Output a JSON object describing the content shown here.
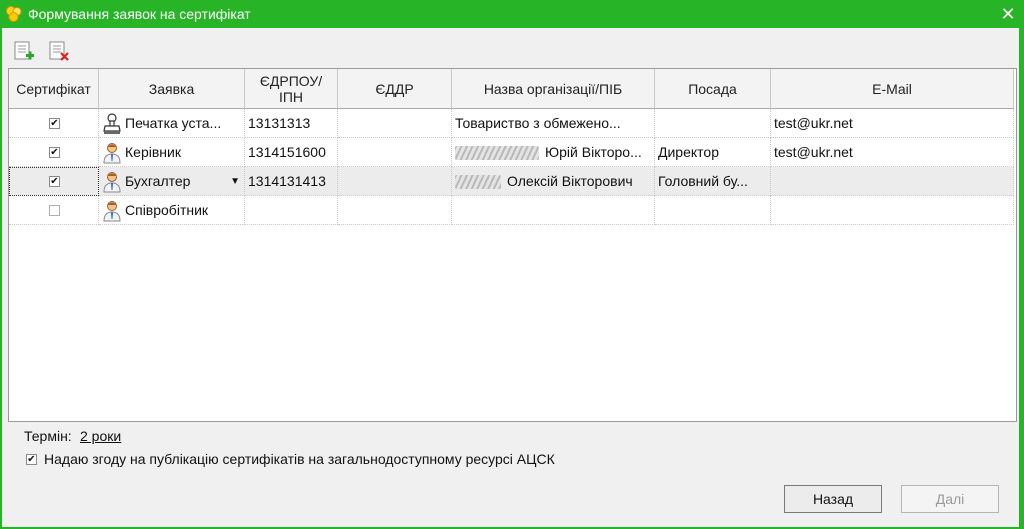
{
  "window": {
    "title": "Формування заявок на сертифікат",
    "close_glyph": "✕",
    "colors": {
      "titlebar": "#27b427",
      "client": "#f0f0f0"
    }
  },
  "toolbar": {
    "add_icon": "add-request-icon",
    "delete_icon": "delete-request-icon"
  },
  "table": {
    "headers": {
      "cert": "Сертифікат",
      "request": "Заявка",
      "edrpou": "ЄДРПОУ/\nІПН",
      "eddr": "ЄДДР",
      "org": "Назва організації/ПІБ",
      "position": "Посада",
      "email": "E-Mail"
    },
    "rows": [
      {
        "checked": "✔",
        "type": "Печатка уста...",
        "icon": "stamp-icon",
        "edrpou": "13131313",
        "eddr": "",
        "org": "Товариство з обмежено...",
        "position": "",
        "email": "test@ukr.net"
      },
      {
        "checked": "✔",
        "type": "Керівник",
        "icon": "person-icon",
        "edrpou": "1314151600",
        "eddr": "",
        "org": "Юрій Вікторо...",
        "position": "Директор",
        "email": "test@ukr.net"
      },
      {
        "checked": "✔",
        "type": "Бухгалтер",
        "icon": "person-icon",
        "edrpou": "1314131413",
        "eddr": "",
        "org": "Олексій Вікторович",
        "position": "Головний бу...",
        "email": ""
      },
      {
        "checked": "",
        "type": "Співробітник",
        "icon": "person-icon",
        "edrpou": "",
        "eddr": "",
        "org": "",
        "position": "",
        "email": ""
      }
    ]
  },
  "term": {
    "label": "Термін:",
    "value": "2 роки"
  },
  "consent": {
    "checked": "✔",
    "text": "Надаю згоду на публікацію сертифікатів на загальнодоступному ресурсі АЦСК"
  },
  "buttons": {
    "back": "Назад",
    "next": "Далі"
  }
}
